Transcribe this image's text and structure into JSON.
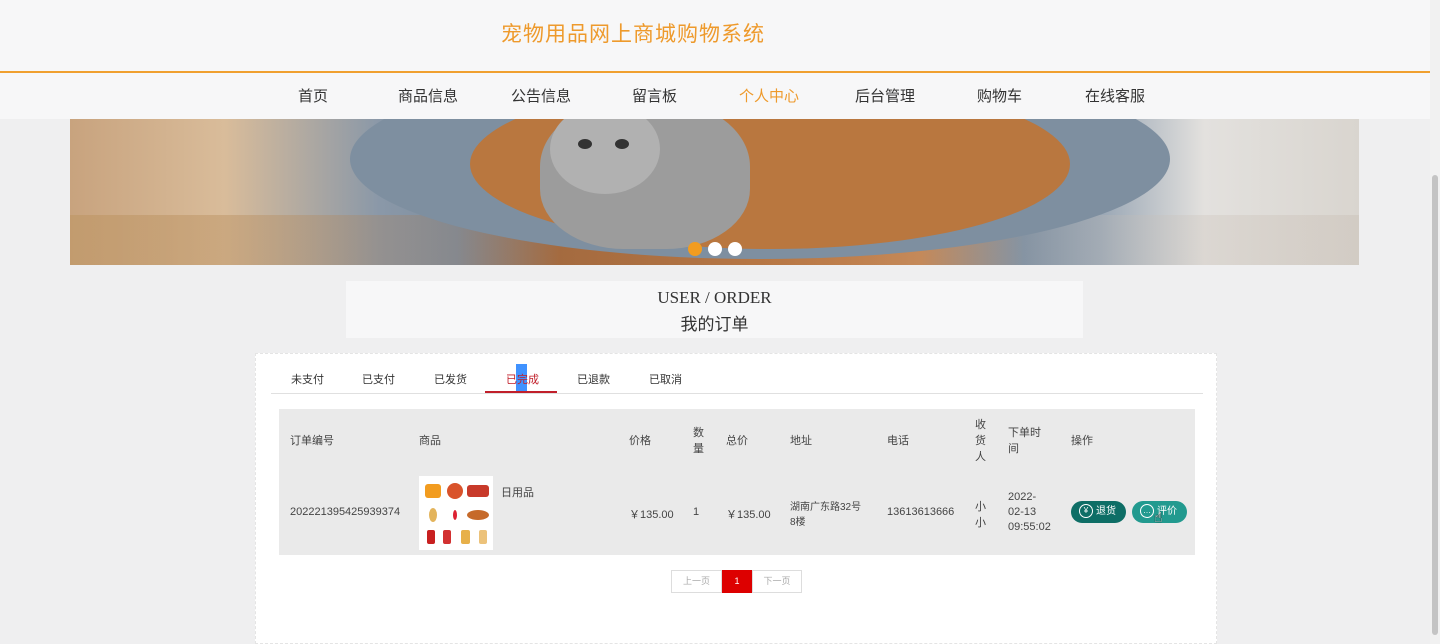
{
  "header": {
    "site_title": "宠物用品网上商城购物系统"
  },
  "nav": {
    "items": [
      {
        "label": "首页"
      },
      {
        "label": "商品信息"
      },
      {
        "label": "公告信息"
      },
      {
        "label": "留言板"
      },
      {
        "label": "个人中心"
      },
      {
        "label": "后台管理"
      },
      {
        "label": "购物车"
      },
      {
        "label": "在线客服"
      }
    ],
    "active": "个人中心"
  },
  "banner": {
    "slides": 3,
    "active_slide": 1
  },
  "section": {
    "title_en": "USER / ORDER",
    "title_cn": "我的订单"
  },
  "tabs": {
    "items": [
      {
        "label": "未支付"
      },
      {
        "label": "已支付"
      },
      {
        "label": "已发货"
      },
      {
        "label": "已完成"
      },
      {
        "label": "已退款"
      },
      {
        "label": "已取消"
      }
    ],
    "active": "已完成"
  },
  "table": {
    "headers": {
      "order_no": "订单编号",
      "product": "商品",
      "price": "价格",
      "qty_1": "数",
      "qty_2": "量",
      "total": "总价",
      "address": "地址",
      "phone": "电话",
      "receiver_1": "收",
      "receiver_2": "货",
      "receiver_3": "人",
      "time_1": "下单时",
      "time_2": "间",
      "action": "操作"
    },
    "rows": [
      {
        "order_no": "202221395425939374",
        "product_name": "日用品",
        "price": "￥135.00",
        "qty": "1",
        "total": "￥135.00",
        "address_1": "湖南广东路32号",
        "address_2": "8楼",
        "phone": "13613613666",
        "receiver_1": "小",
        "receiver_2": "小",
        "time_1": "2022-",
        "time_2": "02-13",
        "time_3": "09:55:02",
        "btn_return": "退货",
        "btn_review": "评价"
      }
    ]
  },
  "pager": {
    "prev": "上一页",
    "current": "1",
    "next": "下一页"
  },
  "colors": {
    "accent": "#ee9a2c",
    "tab_active": "#c11f2a",
    "teal": "#229a8f",
    "page_active": "#dd0000"
  }
}
